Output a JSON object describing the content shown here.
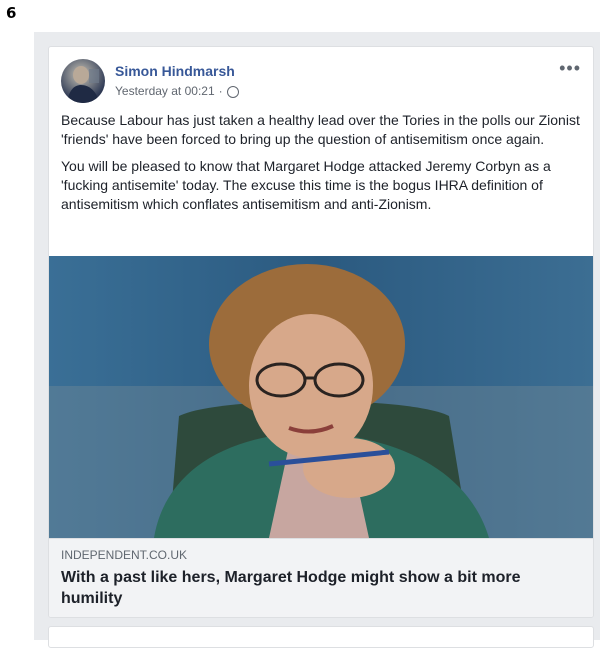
{
  "page_number": "6",
  "post": {
    "author": "Simon Hindmarsh",
    "timestamp": "Yesterday at 00:21",
    "separator": "·",
    "privacy_icon": "globe-icon",
    "more_icon": "ellipsis-icon",
    "more_label": "•••",
    "paragraphs": [
      "Because Labour has just taken a healthy lead over the Tories in the polls our Zionist 'friends' have been forced to bring up the question of antisemitism once again.",
      "You will be pleased to know that Margaret Hodge attacked Jeremy Corbyn as a 'fucking antisemite' today. The excuse this time is the bogus IHRA definition of antisemitism which conflates antisemitism and anti-Zionism."
    ],
    "link": {
      "domain": "INDEPENDENT.CO.UK",
      "headline": "With a past like hers, Margaret Hodge might show a bit more humility"
    }
  },
  "colors": {
    "author": "#385898",
    "feed_background": "#e9ebee",
    "link_meta_background": "#f2f3f5",
    "text": "#1d2129"
  }
}
